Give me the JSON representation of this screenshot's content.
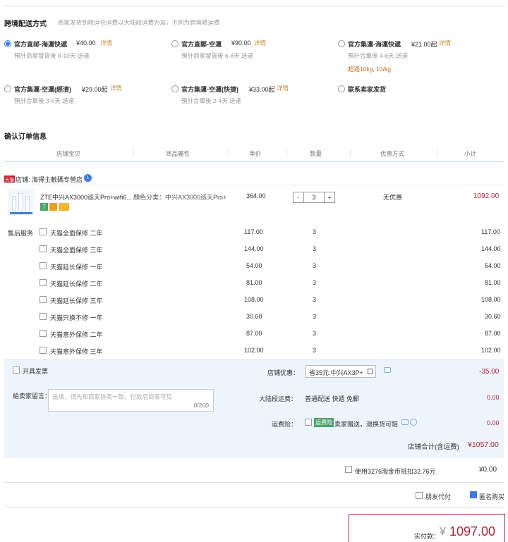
{
  "shipping": {
    "title": "跨境配送方式",
    "hint": "商家发货到转运仓运费以大陆段运费为准，下列为跨境转运费",
    "options": [
      {
        "name": "官方直邮-海運快遞",
        "price": "¥40.00",
        "detail": "详情",
        "sub": "預計商家發貨後 8-10天 送達",
        "extra": "",
        "selected": true
      },
      {
        "name": "官方直郵-空運",
        "price": "¥90.00",
        "detail": "详情",
        "sub": "預計商家發貨後 6-8天 送達",
        "extra": "",
        "selected": false
      },
      {
        "name": "官方集運-海運快遞",
        "price": "¥21.00起",
        "detail": "详情",
        "sub": "預計合單後 4-6天 送達",
        "extra": "超過10kg, 10/kg",
        "selected": false
      },
      {
        "name": "官方集運-空運(經濟)",
        "price": "¥29.00起",
        "detail": "详情",
        "sub": "預計合單後 3-5天 送達",
        "extra": "",
        "selected": false
      },
      {
        "name": "官方集運-空運(快捷)",
        "price": "¥33.00起",
        "detail": "详情",
        "sub": "預計合單後 2-4天 送達",
        "extra": "",
        "selected": false
      },
      {
        "name": "联系卖家发货",
        "price": "",
        "detail": "",
        "sub": "",
        "extra": "",
        "selected": false
      }
    ]
  },
  "order": {
    "title": "确认订单信息",
    "columns": [
      "店铺宝贝",
      "商品屬性",
      "单价",
      "数量",
      "优惠方式",
      "小计"
    ],
    "shop_label": "店铺: 海得主數碼专營店",
    "shop_badge": "1",
    "shop_tag": "天猫",
    "product": {
      "name": "ZTE中兴AX3000巡天Pro+wifi6...",
      "attr": "顏色分类：中兴AX3000巡天Pro+",
      "price": "364.00",
      "qty": "3",
      "discount": "无优惠",
      "subtotal": "1092.00",
      "qty_minus": "-",
      "qty_plus": "+"
    },
    "service_label": "售后服务",
    "services": [
      {
        "name": "天猫全面保修 二年",
        "price": "117.00",
        "qty": "3",
        "subtotal": "117.00"
      },
      {
        "name": "天猫全面保修 三年",
        "price": "144.00",
        "qty": "3",
        "subtotal": "144.00"
      },
      {
        "name": "天猫延长保修 一年",
        "price": "54.00",
        "qty": "3",
        "subtotal": "54.00"
      },
      {
        "name": "天猫延长保修 二年",
        "price": "81.00",
        "qty": "3",
        "subtotal": "81.00"
      },
      {
        "name": "天猫延长保修 三年",
        "price": "108.00",
        "qty": "3",
        "subtotal": "108.00"
      },
      {
        "name": "天猫只换不修 一年",
        "price": "30.60",
        "qty": "3",
        "subtotal": "30.60"
      },
      {
        "name": "天猫意外保修 二年",
        "price": "87.00",
        "qty": "3",
        "subtotal": "87.00"
      },
      {
        "name": "天猫意外保修 三年",
        "price": "102.00",
        "qty": "3",
        "subtotal": "102.00"
      }
    ]
  },
  "summary": {
    "invoice_label": "开具发票",
    "shop_discount_label": "店铺优惠：",
    "shop_discount_value": "省35元:中兴AX3P+",
    "shop_discount_amount": "-35.00",
    "message_label": "給卖家留言：",
    "message_placeholder": "选填，请先和商家协商一致，付款后商家可见",
    "message_counter": "0/200",
    "mainland_shipping_label": "大陆段运费：",
    "mainland_shipping_value": "普通配送 快遞 免郵",
    "mainland_shipping_amount": "0.00",
    "freight_ins_label": "运费险：",
    "freight_ins_tag": "运费险",
    "freight_ins_value": "卖家赠送，退换货可賠",
    "freight_ins_amount": "0.00",
    "shop_total_label": "店铺合计(含运费)",
    "shop_total_value": "¥1057.00"
  },
  "coins": {
    "label": "使用3276淘金币抵扣32.76元",
    "value": "¥0.00"
  },
  "options": {
    "friend_pay": "朋友代付",
    "anonymous": "匿名购买"
  },
  "payment": {
    "label": "实付款：",
    "currency": "¥",
    "amount": "1097.00"
  },
  "colors": {
    "accent_blue": "#3b7be0",
    "price_red": "#b0223b",
    "detail_orange": "#c98c3e",
    "panel_bg": "#eef4fb"
  }
}
